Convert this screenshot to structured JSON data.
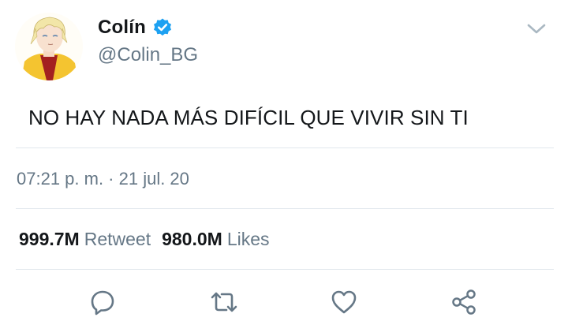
{
  "user": {
    "display_name": "Colín",
    "handle": "@Colin_BG",
    "verified": true
  },
  "tweet": {
    "text": "NO HAY NADA MÁS DIFÍCIL QUE VIVIR SIN TI",
    "timestamp": "07:21 p. m. · 21 jul. 20"
  },
  "stats": {
    "retweets_count": "999.7M",
    "retweets_label": "Retweet",
    "likes_count": "980.0M",
    "likes_label": "Likes"
  },
  "icons": {
    "verified": "verified-badge-icon",
    "menu": "chevron-down-icon",
    "reply": "reply-icon",
    "retweet": "retweet-icon",
    "like": "heart-icon",
    "share": "share-icon"
  },
  "colors": {
    "text": "#14171a",
    "secondary": "#657786",
    "verified": "#1da1f2",
    "divider": "#e1e8ed",
    "icon": "#657786"
  }
}
